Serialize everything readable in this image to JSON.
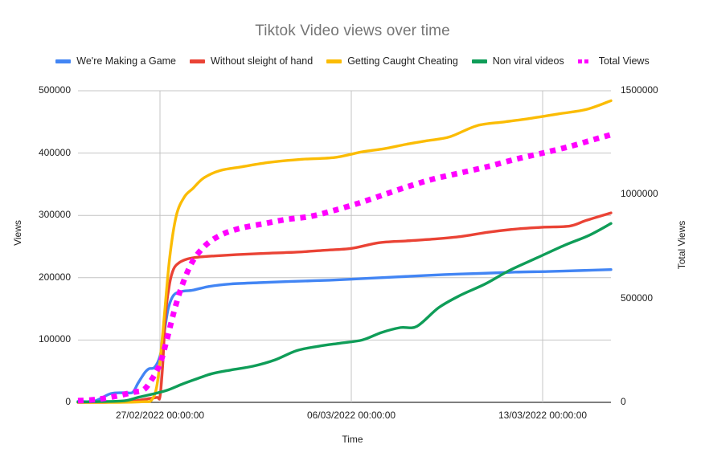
{
  "chart_data": {
    "type": "line",
    "title": "Tiktok Video views over time",
    "xlabel": "Time",
    "ylabel": "Views",
    "y2label": "Total Views",
    "grid": true,
    "legend_position": "top",
    "xlim": [
      "24/02/2022 00:00:00",
      "15/03/2022 12:00:00"
    ],
    "x_tick_labels": [
      "27/02/2022 00:00:00",
      "06/03/2022 00:00:00",
      "13/03/2022 00:00:00"
    ],
    "x_tick_positions_days": [
      3,
      10,
      17
    ],
    "ylim": [
      0,
      500000
    ],
    "y_tick_labels": [
      "0",
      "100000",
      "200000",
      "300000",
      "400000",
      "500000"
    ],
    "y2lim": [
      0,
      1500000
    ],
    "y2_tick_labels": [
      "0",
      "500000",
      "1000000",
      "1500000"
    ],
    "series": [
      {
        "name": "We're Making a Game",
        "color": "#4285F4",
        "axis": "left",
        "style": "solid",
        "x": [
          0,
          0.6,
          1.2,
          1.7,
          2.0,
          2.2,
          2.45,
          2.6,
          2.8,
          3.0,
          3.15,
          3.3,
          3.5,
          3.8,
          4.2,
          4.8,
          5.6,
          6.6,
          7.8,
          9.2,
          10.6,
          12.0,
          13.4,
          14.8,
          16.0,
          17.2,
          18.4,
          19.5
        ],
        "values": [
          1500,
          2000,
          14000,
          15500,
          16000,
          31000,
          48000,
          54000,
          56000,
          74000,
          110000,
          150000,
          172000,
          178000,
          180000,
          186000,
          190000,
          192000,
          194000,
          196000,
          199000,
          202000,
          205000,
          207000,
          209000,
          210000,
          211500,
          213000
        ]
      },
      {
        "name": "Without sleight of hand",
        "color": "#EA4335",
        "axis": "left",
        "style": "solid",
        "x": [
          0,
          1.0,
          2.0,
          2.6,
          2.9,
          3.0,
          3.1,
          3.2,
          3.35,
          3.5,
          3.7,
          4.0,
          4.4,
          5.0,
          5.8,
          6.8,
          8.0,
          9.0,
          10.0,
          11.0,
          12.0,
          13.0,
          14.0,
          15.0,
          16.0,
          17.0,
          18.0,
          18.6,
          19.5
        ],
        "values": [
          0,
          0,
          2000,
          6000,
          8000,
          9000,
          60000,
          140000,
          190000,
          214000,
          224000,
          230000,
          233000,
          235000,
          237000,
          239000,
          241000,
          244000,
          247000,
          256000,
          259000,
          262000,
          266000,
          273000,
          278000,
          281000,
          283000,
          292000,
          304000
        ]
      },
      {
        "name": "Getting Caught Cheating",
        "color": "#FBBC04",
        "axis": "left",
        "style": "solid",
        "x": [
          0,
          1.5,
          2.4,
          2.7,
          2.9,
          3.1,
          3.35,
          3.6,
          3.9,
          4.2,
          4.6,
          5.2,
          6.0,
          7.0,
          8.2,
          9.4,
          10.4,
          11.2,
          12.0,
          12.8,
          13.6,
          14.6,
          15.6,
          16.6,
          17.6,
          18.6,
          19.5
        ],
        "values": [
          0,
          0,
          1000,
          4000,
          30000,
          110000,
          230000,
          300000,
          330000,
          343000,
          360000,
          372000,
          378000,
          385000,
          390000,
          393000,
          402000,
          407000,
          414000,
          420000,
          426000,
          444000,
          450000,
          456000,
          463000,
          470000,
          484000
        ]
      },
      {
        "name": "Non viral videos",
        "color": "#0F9D58",
        "axis": "left",
        "style": "solid",
        "x": [
          0,
          0.8,
          1.7,
          2.2,
          2.8,
          3.3,
          3.8,
          4.3,
          4.9,
          5.6,
          6.4,
          7.2,
          8.0,
          8.8,
          9.6,
          10.4,
          11.1,
          11.8,
          12.4,
          13.2,
          14.0,
          14.9,
          15.8,
          16.8,
          17.8,
          18.7,
          19.5
        ],
        "values": [
          500,
          1200,
          2500,
          8000,
          14000,
          20000,
          29000,
          37000,
          46000,
          52000,
          58000,
          68000,
          83000,
          90000,
          95000,
          100000,
          112000,
          120000,
          122000,
          152000,
          172000,
          190000,
          212000,
          232000,
          252000,
          268000,
          287000
        ]
      },
      {
        "name": "Total Views",
        "color": "#FF00FF",
        "axis": "right",
        "style": "dotted",
        "x": [
          0,
          0.7,
          1.4,
          2.0,
          2.4,
          2.7,
          3.0,
          3.25,
          3.5,
          3.8,
          4.2,
          4.7,
          5.3,
          6.0,
          6.8,
          7.6,
          8.5,
          9.4,
          10.3,
          11.2,
          12.1,
          13.0,
          14.0,
          15.0,
          16.0,
          17.0,
          18.0,
          19.0,
          19.5
        ],
        "values": [
          8000,
          14000,
          30000,
          48000,
          60000,
          110000,
          185000,
          300000,
          430000,
          560000,
          680000,
          760000,
          810000,
          840000,
          860000,
          880000,
          895000,
          925000,
          960000,
          1000000,
          1040000,
          1075000,
          1105000,
          1135000,
          1170000,
          1200000,
          1232000,
          1270000,
          1288000
        ]
      }
    ]
  },
  "axes": {
    "y_left": {
      "title": "Views",
      "ticks": [
        "500000",
        "400000",
        "300000",
        "200000",
        "100000",
        "0"
      ]
    },
    "y_right": {
      "title": "Total Views",
      "ticks": [
        "1500000",
        "1000000",
        "500000",
        "0"
      ]
    },
    "x": {
      "title": "Time",
      "ticks": [
        "27/02/2022 00:00:00",
        "06/03/2022 00:00:00",
        "13/03/2022 00:00:00"
      ]
    }
  },
  "legend": {
    "items": [
      {
        "label": "We're Making a Game",
        "color": "#4285F4",
        "style": "solid"
      },
      {
        "label": "Without sleight of hand",
        "color": "#EA4335",
        "style": "solid"
      },
      {
        "label": "Getting Caught Cheating",
        "color": "#FBBC04",
        "style": "solid"
      },
      {
        "label": "Non viral videos",
        "color": "#0F9D58",
        "style": "solid"
      },
      {
        "label": "Total Views",
        "color": "#FF00FF",
        "style": "dotted"
      }
    ]
  }
}
